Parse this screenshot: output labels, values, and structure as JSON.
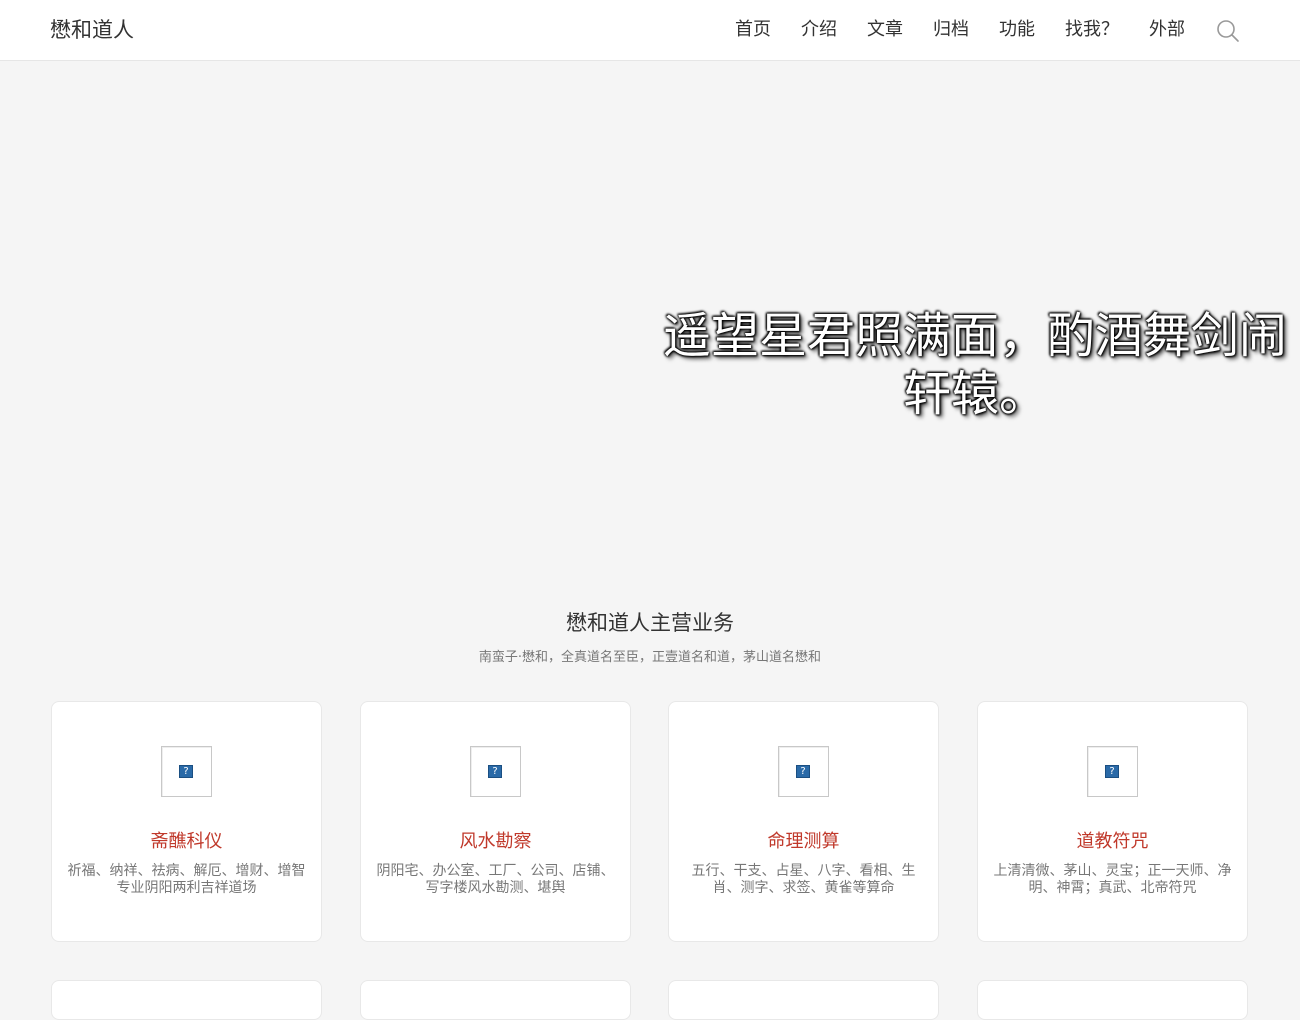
{
  "header": {
    "site_title": "懋和道人",
    "nav": [
      {
        "label": "首页"
      },
      {
        "label": "介绍"
      },
      {
        "label": "文章"
      },
      {
        "label": "归档"
      },
      {
        "label": "功能"
      },
      {
        "label": "找我？"
      },
      {
        "label": "外部"
      }
    ],
    "search_icon": "search-icon"
  },
  "hero": {
    "text": "遥望星君照满面，酌酒舞剑闹轩辕。"
  },
  "services": {
    "title": "懋和道人主营业务",
    "subtitle": "南蛮子·懋和，全真道名至臣，正壹道名和道，茅山道名懋和",
    "cards": [
      {
        "title": "斋醮科仪",
        "desc": "祈福、纳祥、祛病、解厄、增财、增智专业阴阳两利吉祥道场",
        "image_icon": "broken-image-icon"
      },
      {
        "title": "风水勘察",
        "desc": "阴阳宅、办公室、工厂、公司、店铺、写字楼风水勘测、堪舆",
        "image_icon": "broken-image-icon"
      },
      {
        "title": "命理测算",
        "desc": "五行、干支、占星、八字、看相、生肖、测字、求签、黄雀等算命",
        "image_icon": "broken-image-icon"
      },
      {
        "title": "道教符咒",
        "desc": "上清清微、茅山、灵宝；正一天师、净明、神霄；真武、北帝符咒",
        "image_icon": "broken-image-icon"
      }
    ]
  },
  "colors": {
    "accent": "#c0392b",
    "background": "#f5f5f5"
  }
}
